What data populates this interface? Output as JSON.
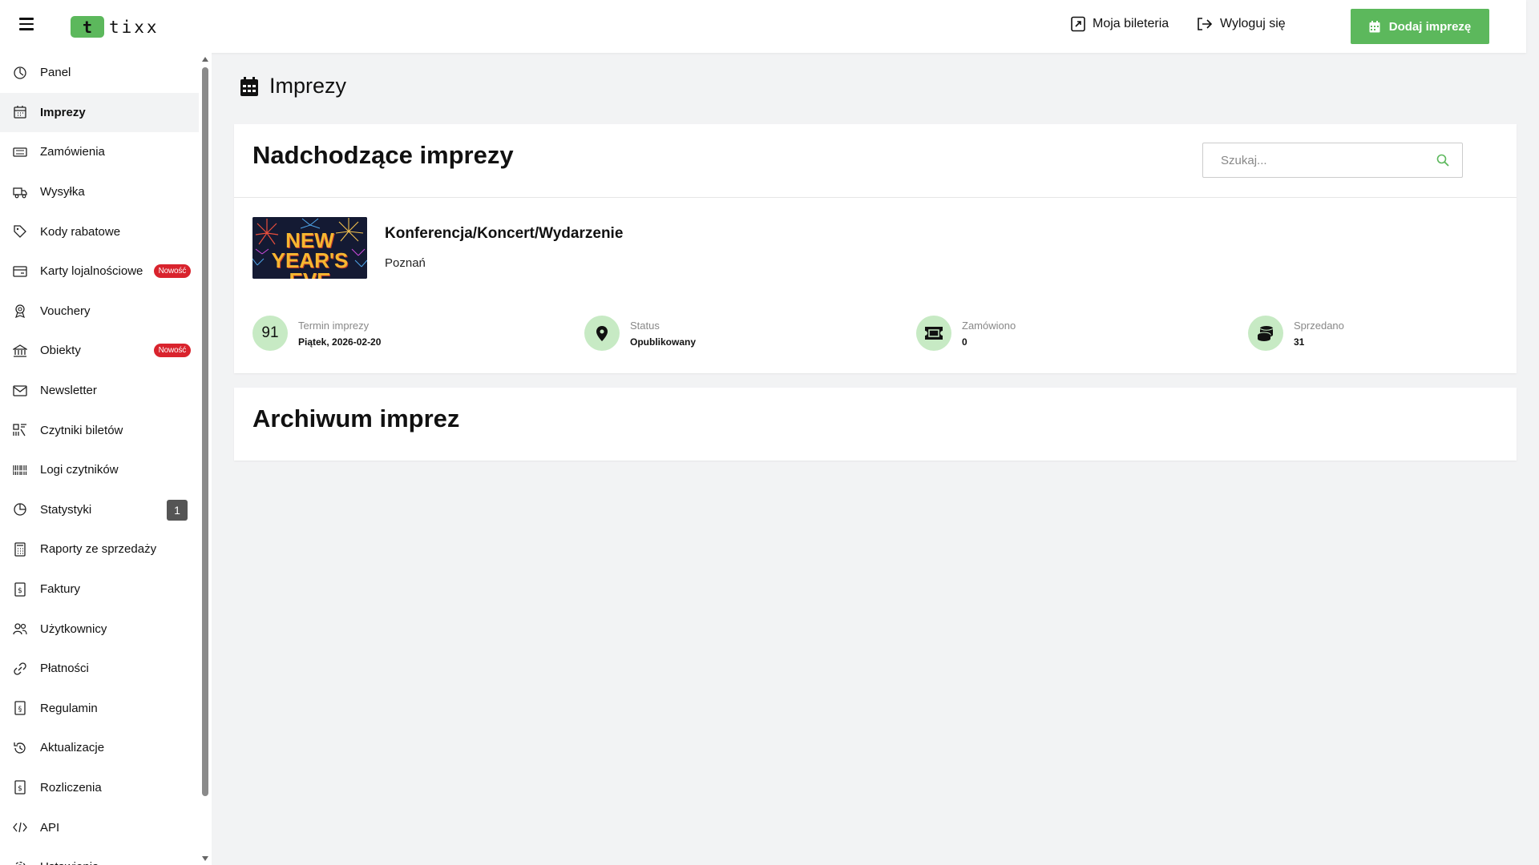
{
  "header": {
    "logo_letter": "t",
    "logo_text": "tixx",
    "my_box_office": "Moja bileteria",
    "logout": "Wyloguj się",
    "add_event": "Dodaj imprezę"
  },
  "sidebar": {
    "items": [
      {
        "label": "Panel",
        "icon": "dashboard-icon"
      },
      {
        "label": "Imprezy",
        "icon": "calendar-icon",
        "active": true
      },
      {
        "label": "Zamówienia",
        "icon": "ticket-icon"
      },
      {
        "label": "Wysyłka",
        "icon": "truck-icon"
      },
      {
        "label": "Kody rabatowe",
        "icon": "tag-icon"
      },
      {
        "label": "Karty lojalnościowe",
        "icon": "card-icon",
        "badge": "Nowość"
      },
      {
        "label": "Vouchery",
        "icon": "voucher-icon"
      },
      {
        "label": "Obiekty",
        "icon": "building-icon",
        "badge": "Nowość"
      },
      {
        "label": "Newsletter",
        "icon": "envelope-icon"
      },
      {
        "label": "Czytniki biletów",
        "icon": "scanner-icon"
      },
      {
        "label": "Logi czytników",
        "icon": "barcode-icon"
      },
      {
        "label": "Statystyki",
        "icon": "pie-chart-icon",
        "count": "1"
      },
      {
        "label": "Raporty ze sprzedaży",
        "icon": "calculator-icon"
      },
      {
        "label": "Faktury",
        "icon": "invoice-icon"
      },
      {
        "label": "Użytkownicy",
        "icon": "users-icon"
      },
      {
        "label": "Płatności",
        "icon": "link-icon"
      },
      {
        "label": "Regulamin",
        "icon": "document-icon"
      },
      {
        "label": "Aktualizacje",
        "icon": "history-icon"
      },
      {
        "label": "Rozliczenia",
        "icon": "receipt-icon"
      },
      {
        "label": "API",
        "icon": "code-icon"
      },
      {
        "label": "Ustawienia",
        "icon": "gear-icon"
      }
    ]
  },
  "main": {
    "page_title": "Imprezy",
    "upcoming": {
      "title": "Nadchodzące imprezy",
      "search_placeholder": "Szukaj...",
      "events": [
        {
          "name": "Konferencja/Koncert/Wydarzenie",
          "city": "Poznań",
          "thumbnail_text_line1": "NEW",
          "thumbnail_text_line2": "YEAR'S",
          "thumbnail_text_line3": "EVE",
          "days": "91",
          "date_label": "Termin imprezy",
          "date_value": "Piątek, 2026-02-20",
          "status_label": "Status",
          "status_value": "Opublikowany",
          "ordered_label": "Zamówiono",
          "ordered_value": "0",
          "sold_label": "Sprzedano",
          "sold_value": "31"
        }
      ]
    },
    "archive": {
      "title": "Archiwum imprez"
    }
  },
  "colors": {
    "accent": "#5cb85c",
    "badge_red": "#d9232d",
    "stat_circle": "#c7eac4",
    "background": "#f2f3f4"
  }
}
